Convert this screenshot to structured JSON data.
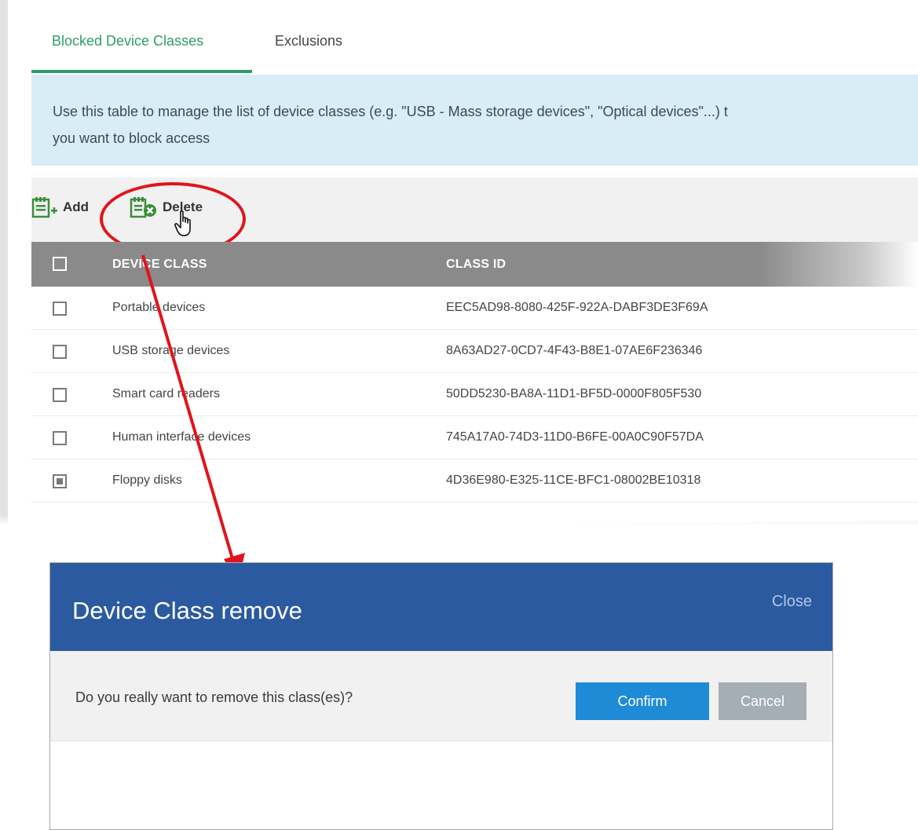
{
  "tabs": [
    {
      "label": "Blocked Device Classes",
      "active": true
    },
    {
      "label": "Exclusions",
      "active": false
    }
  ],
  "info": {
    "line1": "Use this table to manage the list of device classes (e.g. \"USB - Mass storage devices\", \"Optical devices\"...) t",
    "line2": "you want to block access"
  },
  "toolbar": {
    "add_label": "Add",
    "delete_label": "Delete"
  },
  "table": {
    "columns": [
      "DEVICE CLASS",
      "CLASS ID"
    ],
    "rows": [
      {
        "device_class": "Portable devices",
        "class_id": "EEC5AD98-8080-425F-922A-DABF3DE3F69A",
        "checked": false
      },
      {
        "device_class": "USB storage devices",
        "class_id": "8A63AD27-0CD7-4F43-B8E1-07AE6F236346",
        "checked": false
      },
      {
        "device_class": "Smart card readers",
        "class_id": "50DD5230-BA8A-11D1-BF5D-0000F805F530",
        "checked": false
      },
      {
        "device_class": "Human interface devices",
        "class_id": "745A17A0-74D3-11D0-B6FE-00A0C90F57DA",
        "checked": false
      },
      {
        "device_class": "Floppy disks",
        "class_id": "4D36E980-E325-11CE-BFC1-08002BE10318",
        "checked": true
      }
    ]
  },
  "dialog": {
    "title": "Device Class remove",
    "close_label": "Close",
    "message": "Do you really want to remove this class(es)?",
    "confirm_label": "Confirm",
    "cancel_label": "Cancel"
  },
  "colors": {
    "accent_green": "#2e9c6a",
    "dialog_header": "#2b5aa0",
    "confirm_button": "#1f8bd6",
    "cancel_button": "#a5adb5",
    "annotation_red": "#e0141c"
  }
}
